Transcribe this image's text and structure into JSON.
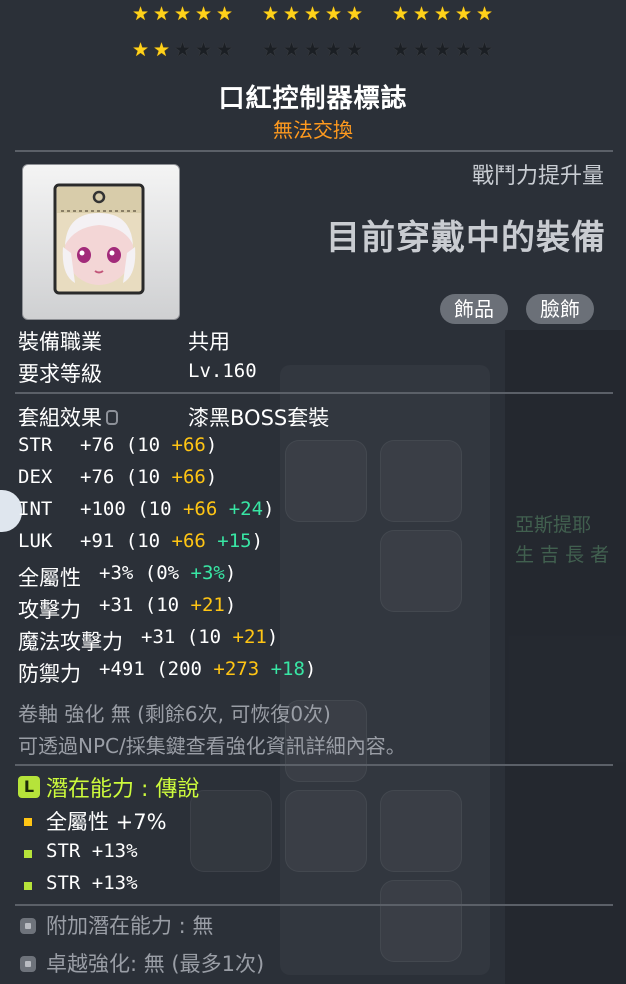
{
  "stars": {
    "rows": [
      [
        [
          1,
          1,
          1,
          1,
          1
        ],
        [
          1,
          1,
          1,
          1,
          1
        ],
        [
          1,
          1,
          1,
          1,
          1
        ]
      ],
      [
        [
          1,
          1,
          0,
          0,
          0
        ],
        [
          0,
          0,
          0,
          0,
          0
        ],
        [
          0,
          0,
          0,
          0,
          0
        ]
      ]
    ]
  },
  "item": {
    "name": "口紅控制器標誌",
    "trade_status": "無法交換"
  },
  "header": {
    "power_label": "戰鬥力提升量",
    "current_equip": "目前穿戴中的裝備"
  },
  "tags": [
    "飾品",
    "臉飾"
  ],
  "info": {
    "job_label": "裝備職業",
    "job_value": "共用",
    "level_label": "要求等級",
    "level_value": "Lv.160",
    "set_label": "套組效果",
    "set_value": "漆黑BOSS套裝"
  },
  "stats": [
    {
      "name": "STR",
      "total": "+76",
      "base": "10",
      "bonus": "+66",
      "extra": ""
    },
    {
      "name": "DEX",
      "total": "+76",
      "base": "10",
      "bonus": "+66",
      "extra": ""
    },
    {
      "name": "INT",
      "total": "+100",
      "base": "10",
      "bonus": "+66",
      "extra": "+24"
    },
    {
      "name": "LUK",
      "total": "+91",
      "base": "10",
      "bonus": "+66",
      "extra": "+15"
    },
    {
      "name": "全屬性",
      "total": "+3%",
      "base": "0%",
      "bonus": "",
      "extra": "+3%"
    },
    {
      "name": "攻擊力",
      "total": "+31",
      "base": "10",
      "bonus": "+21",
      "extra": ""
    },
    {
      "name": "魔法攻擊力",
      "total": "+31",
      "base": "10",
      "bonus": "+21",
      "extra": ""
    },
    {
      "name": "防禦力",
      "total": "+491",
      "base": "200",
      "bonus": "+273",
      "extra": "+18"
    }
  ],
  "upgrade": {
    "scroll_line": "卷軸 強化 無 (剩餘6次, 可恢復0次)",
    "npc_line": "可透過NPC/採集鍵查看強化資訊詳細內容。"
  },
  "potential": {
    "badge": "L",
    "title": "潛在能力 : 傳說",
    "lines": [
      "全屬性 +7%",
      "STR +13%",
      "STR +13%"
    ]
  },
  "additional_potential": "附加潛在能力 : 無",
  "exceptional": "卓越強化:  無 (最多1次)",
  "colors": {
    "trade": "#ff9a1e",
    "bonus_yellow": "#ffc514",
    "extra_green": "#38e6a4",
    "potential_green": "#cdfb3c",
    "bullet_yellow": "#ffc514",
    "bullet_green": "#b6e33a"
  },
  "background": {
    "right_text_1": "亞斯提耶",
    "right_text_2": "生 吉 長 者"
  }
}
